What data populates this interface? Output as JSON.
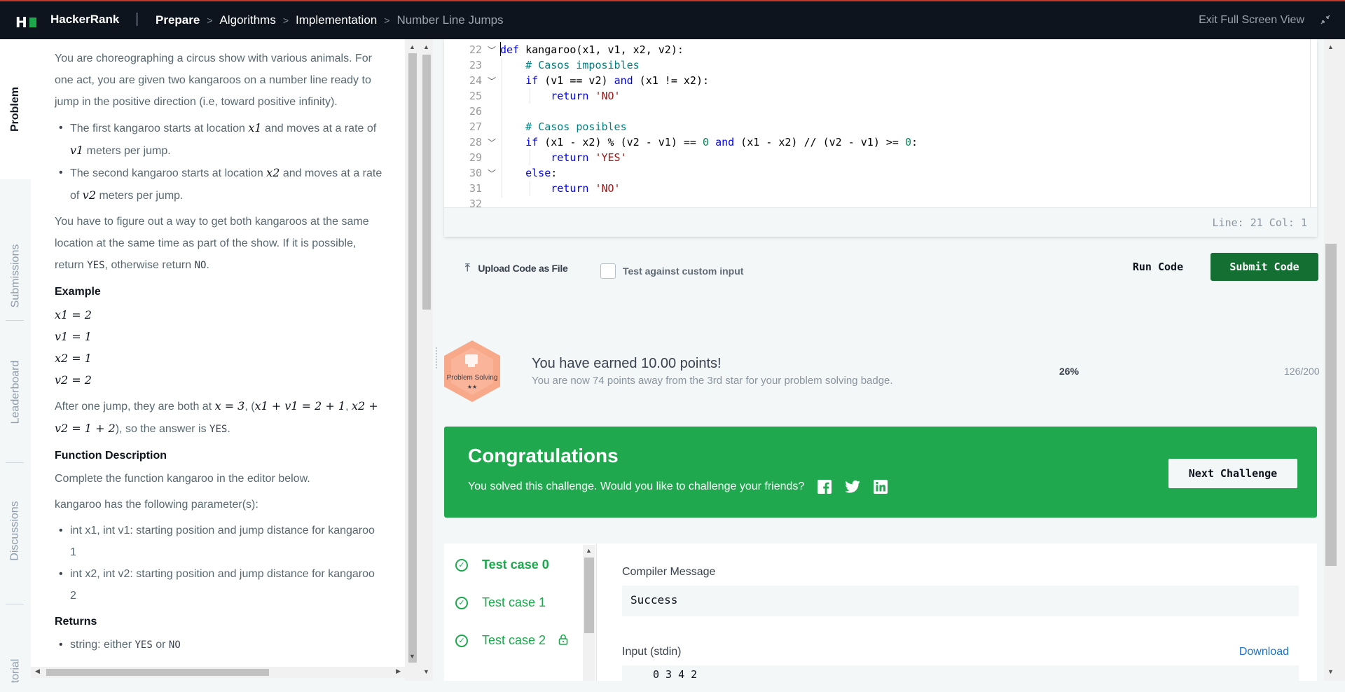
{
  "nav": {
    "brand": "HackerRank",
    "separator": "|",
    "breadcrumbs": [
      "Prepare",
      "Algorithms",
      "Implementation",
      "Number Line Jumps"
    ],
    "exit_label": "Exit Full Screen View"
  },
  "side_tabs": [
    "Problem",
    "Submissions",
    "Leaderboard",
    "Discussions",
    "torial"
  ],
  "problem": {
    "intro": "You are choreographing a circus show with various animals. For one act, you are given two kangaroos on a number line ready to jump in the positive direction (i.e, toward positive infinity).",
    "bullet1_a": "The first kangaroo starts at location ",
    "bullet1_b": " and moves at a rate of ",
    "bullet1_c": " meters per jump.",
    "bullet2_a": "The second kangaroo starts at location ",
    "bullet2_b": " and moves at a rate of ",
    "bullet2_c": " meters per jump.",
    "x1": "x1",
    "v1": "v1",
    "x2": "x2",
    "v2": "v2",
    "para2_a": "You have to figure out a way to get both kangaroos at the same location at the same time as part of the show. If it is possible, return ",
    "yes": "YES",
    "para2_b": ", otherwise return ",
    "no": "NO",
    "period": ".",
    "example_heading": "Example",
    "example_lines": [
      "x1 = 2",
      "v1 = 1",
      "x2 = 1",
      "v2 = 2"
    ],
    "after_a": "After one jump, they are both at ",
    "after_eq1": "x = 3",
    "after_b": ", (",
    "after_eq2": "x1 + v1 = 2 + 1",
    "after_c": ",",
    "after_eq3": "x2 + v2 = 1 + 2",
    "after_d": "), so the answer is ",
    "func_heading": "Function Description",
    "func_desc": "Complete the function kangaroo in the editor below.",
    "params_intro": "kangaroo has the following parameter(s):",
    "param1": "int x1, int v1: starting position and jump distance for kangaroo 1",
    "param2": "int x2, int v2: starting position and jump distance for kangaroo 2",
    "returns_heading": "Returns",
    "returns_a": "string: either ",
    "returns_b": " or "
  },
  "editor": {
    "line_numbers": [
      "22",
      "23",
      "24",
      "25",
      "26",
      "27",
      "28",
      "29",
      "30",
      "31",
      "32"
    ],
    "code_lines": [
      "def kangaroo(x1, v1, x2, v2):",
      "    # Casos imposibles",
      "    if (v1 == v2) and (x1 != x2):",
      "        return 'NO'",
      "",
      "    # Casos posibles",
      "    if (x1 - x2) % (v2 - v1) == 0 and (x1 - x2) // (v2 - v1) >= 0:",
      "        return 'YES'",
      "    else:",
      "        return 'NO'",
      ""
    ],
    "status": "Line: 21 Col: 1"
  },
  "actions": {
    "upload_label": "Upload Code as File",
    "custom_input_label": "Test against custom input",
    "run_label": "Run Code",
    "submit_label": "Submit Code"
  },
  "points": {
    "badge_label": "Problem Solving",
    "badge_stars": "★★",
    "title": "You have earned 10.00 points!",
    "subtitle": "You are now 74 points away from the 3rd star for your problem solving badge.",
    "percent": "26%",
    "progress": "126/200"
  },
  "congrats": {
    "title": "Congratulations",
    "message": "You solved this challenge. Would you like to challenge your friends?",
    "next_label": "Next Challenge"
  },
  "tests": {
    "cases": [
      "Test case 0",
      "Test case 1",
      "Test case 2"
    ],
    "compiler_label": "Compiler Message",
    "compiler_value": "Success",
    "stdin_label": "Input (stdin)",
    "download_label": "Download",
    "stdin_value": "0 3 4 2"
  },
  "colors": {
    "nav_bg": "#0e141e",
    "accent_green": "#1ba94c",
    "submit_green": "#136f32",
    "congrats_green": "#1fa84d",
    "badge_orange": "#f7a98a",
    "link_blue": "#1a73c8"
  }
}
